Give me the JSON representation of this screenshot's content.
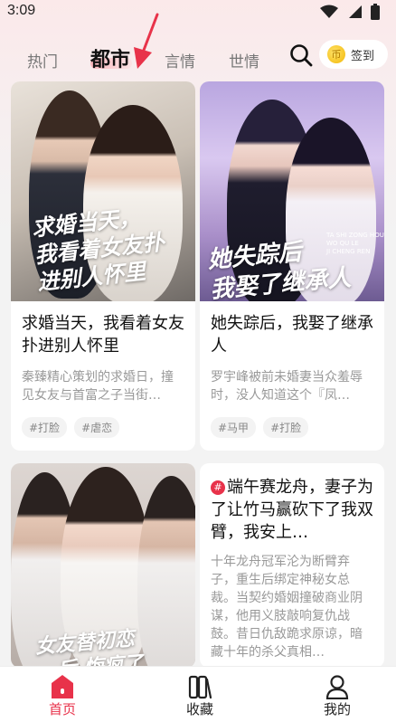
{
  "status_bar": {
    "time": "3:09"
  },
  "tabs": [
    {
      "label": "热门",
      "active": false
    },
    {
      "label": "都市",
      "active": true
    },
    {
      "label": "言情",
      "active": false
    },
    {
      "label": "世情",
      "active": false
    }
  ],
  "signin": {
    "label": "签到",
    "coin_glyph": "币"
  },
  "books": [
    {
      "cover_text": "求婚当天，\n我看着女友扑\n进别人怀里",
      "title": "求婚当天，我看着女友扑进别人怀里",
      "desc": "秦臻精心策划的求婚日，撞见女友与首富之子当街…",
      "tags": [
        "#打脸",
        "#虐恋"
      ]
    },
    {
      "cover_text": "她失踪后\n我娶了继承人",
      "cover_small": "TA SHI ZONG HOU\nWO QU LE\nJI CHENG REN",
      "title": "她失踪后，我娶了继承人",
      "desc": "罗宇峰被前未婚妻当众羞辱时，没人知道这个『凤…",
      "tags": [
        "#马甲",
        "#打脸"
      ]
    },
    {
      "cover_text": "女友替初恋\n…后 悔疯了",
      "title": "",
      "desc": "",
      "tags": []
    },
    {
      "badge": "#",
      "title": "端午赛龙舟，妻子为了让竹马赢砍下了我双臂，我安上…",
      "desc": "十年龙舟冠军沦为断臂弃子，重生后绑定神秘女总裁。当契约婚姻撞破商业阴谋，他用义肢敲响复仇战鼓。昔日仇敌跪求原谅，暗藏十年的杀父真相…",
      "tags": []
    }
  ],
  "bottom_nav": [
    {
      "label": "首页",
      "icon": "home-icon",
      "active": true
    },
    {
      "label": "收藏",
      "icon": "bookshelf-icon",
      "active": false
    },
    {
      "label": "我的",
      "icon": "profile-icon",
      "active": false
    }
  ],
  "colors": {
    "accent": "#e8324a",
    "background_top": "#fbe9ea"
  }
}
